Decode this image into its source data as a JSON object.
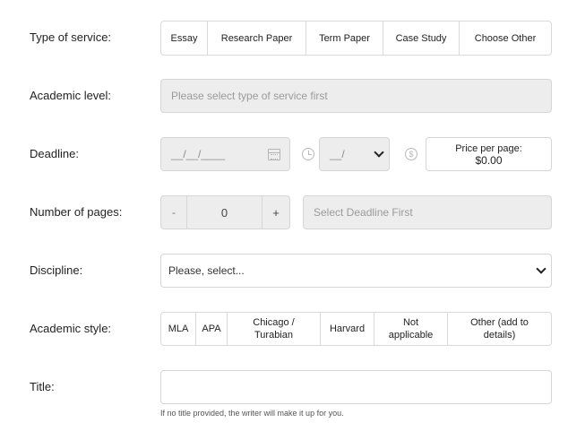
{
  "service": {
    "label": "Type of service:",
    "options": [
      "Essay",
      "Research Paper",
      "Term Paper",
      "Case Study",
      "Choose Other"
    ]
  },
  "academic_level": {
    "label": "Academic level:",
    "placeholder": "Please select type of service first"
  },
  "deadline": {
    "label": "Deadline:",
    "date_placeholder": "__/__/____",
    "time_placeholder": "__/",
    "price_label": "Price per page:",
    "price_value": "$0.00"
  },
  "pages": {
    "label": "Number of pages:",
    "minus": "-",
    "value": "0",
    "plus": "+",
    "deadline_hint": "Select Deadline First"
  },
  "discipline": {
    "label": "Discipline:",
    "placeholder": "Please, select..."
  },
  "style": {
    "label": "Academic style:",
    "options": [
      "MLA",
      "APA",
      "Chicago / Turabian",
      "Harvard",
      "Not applicable",
      "Other (add to details)"
    ]
  },
  "title": {
    "label": "Title:",
    "value": "",
    "hint": "If no title provided, the writer will make it up for you."
  },
  "colors": {
    "disabled_bg": "#ededed",
    "border": "#d6d6d6",
    "text": "#222222",
    "muted": "#9a9a9a"
  },
  "icons": [
    "calendar-icon",
    "clock-icon",
    "dollar-icon",
    "chevron-down-icon"
  ]
}
